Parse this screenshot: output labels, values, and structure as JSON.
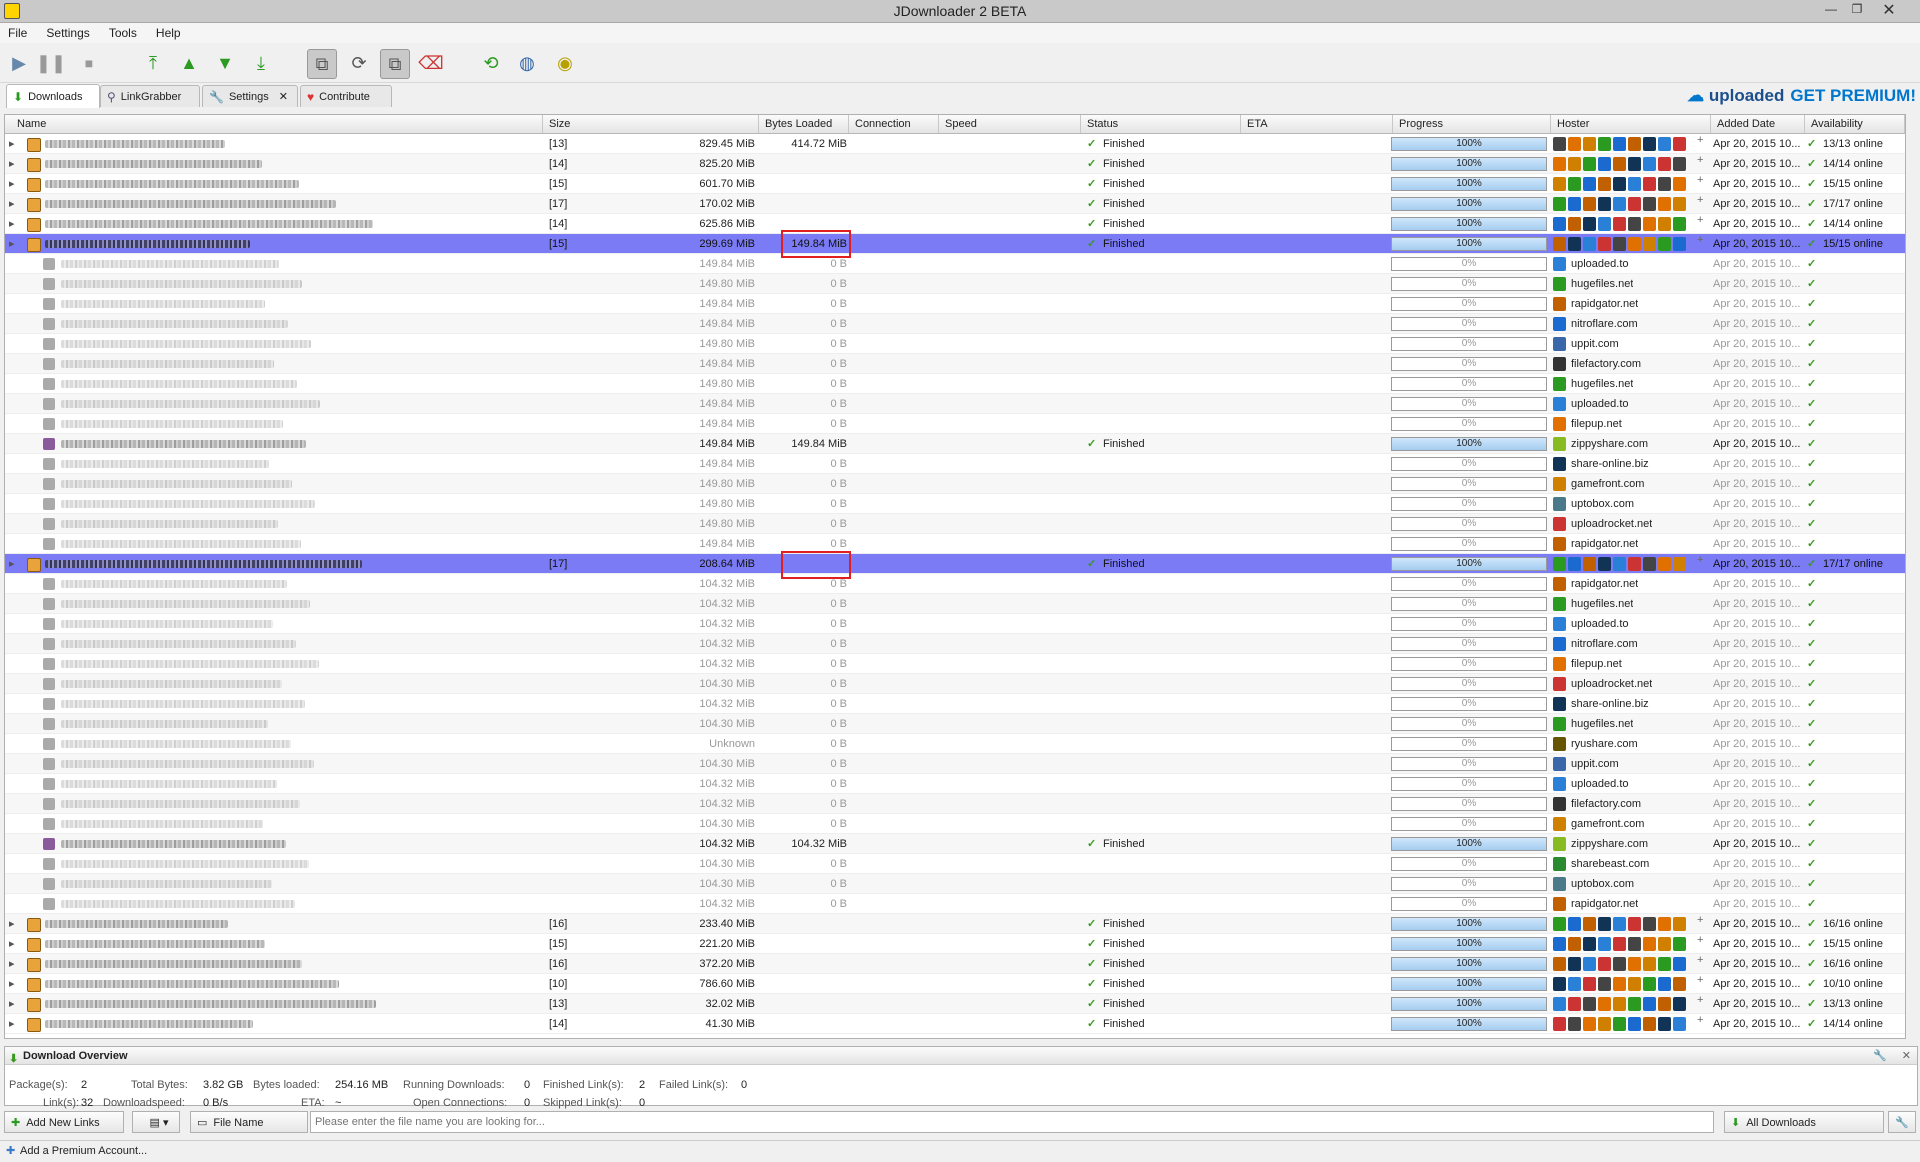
{
  "window": {
    "title": "JDownloader 2 BETA"
  },
  "menu": [
    "File",
    "Settings",
    "Tools",
    "Help"
  ],
  "tabs": [
    {
      "label": "Downloads"
    },
    {
      "label": "LinkGrabber"
    },
    {
      "label": "Settings"
    },
    {
      "label": "Contribute"
    }
  ],
  "banner": {
    "brand": "uploaded",
    "cta": "GET PREMIUM!"
  },
  "columns": [
    "Name",
    "Size",
    "Bytes Loaded",
    "Connection",
    "Speed",
    "Status",
    "ETA",
    "Progress",
    "Hoster",
    "Added Date",
    "Availability"
  ],
  "rows": [
    {
      "kind": "package",
      "count": "[13]",
      "size": "829.45 MiB",
      "loaded": "414.72 MiB",
      "status": "Finished",
      "progress": "100%",
      "date": "Apr 20, 2015 10...",
      "avail": "13/13 online"
    },
    {
      "kind": "package",
      "count": "[14]",
      "size": "825.20 MiB",
      "loaded": "",
      "status": "Finished",
      "progress": "100%",
      "date": "Apr 20, 2015 10...",
      "avail": "14/14 online"
    },
    {
      "kind": "package",
      "count": "[15]",
      "size": "601.70 MiB",
      "loaded": "",
      "status": "Finished",
      "progress": "100%",
      "date": "Apr 20, 2015 10...",
      "avail": "15/15 online"
    },
    {
      "kind": "package",
      "count": "[17]",
      "size": "170.02 MiB",
      "loaded": "",
      "status": "Finished",
      "progress": "100%",
      "date": "Apr 20, 2015 10...",
      "avail": "17/17 online"
    },
    {
      "kind": "package",
      "count": "[14]",
      "size": "625.86 MiB",
      "loaded": "",
      "status": "Finished",
      "progress": "100%",
      "date": "Apr 20, 2015 10...",
      "avail": "14/14 online"
    },
    {
      "kind": "package",
      "selected": true,
      "count": "[15]",
      "size": "299.69 MiB",
      "loaded": "149.84 MiB",
      "status": "Finished",
      "progress": "100%",
      "date": "Apr 20, 2015 10...",
      "avail": "15/15 online"
    },
    {
      "kind": "child",
      "size": "149.84 MiB",
      "loaded": "0 B",
      "progress": "0%",
      "hoster": "uploaded.to",
      "date": "Apr 20, 2015 10..."
    },
    {
      "kind": "child",
      "size": "149.80 MiB",
      "loaded": "0 B",
      "progress": "0%",
      "hoster": "hugefiles.net",
      "date": "Apr 20, 2015 10..."
    },
    {
      "kind": "child",
      "size": "149.84 MiB",
      "loaded": "0 B",
      "progress": "0%",
      "hoster": "rapidgator.net",
      "date": "Apr 20, 2015 10..."
    },
    {
      "kind": "child",
      "size": "149.84 MiB",
      "loaded": "0 B",
      "progress": "0%",
      "hoster": "nitroflare.com",
      "date": "Apr 20, 2015 10..."
    },
    {
      "kind": "child",
      "size": "149.80 MiB",
      "loaded": "0 B",
      "progress": "0%",
      "hoster": "uppit.com",
      "date": "Apr 20, 2015 10..."
    },
    {
      "kind": "child",
      "size": "149.84 MiB",
      "loaded": "0 B",
      "progress": "0%",
      "hoster": "filefactory.com",
      "date": "Apr 20, 2015 10..."
    },
    {
      "kind": "child",
      "size": "149.80 MiB",
      "loaded": "0 B",
      "progress": "0%",
      "hoster": "hugefiles.net",
      "date": "Apr 20, 2015 10..."
    },
    {
      "kind": "child",
      "size": "149.84 MiB",
      "loaded": "0 B",
      "progress": "0%",
      "hoster": "uploaded.to",
      "date": "Apr 20, 2015 10..."
    },
    {
      "kind": "child",
      "size": "149.84 MiB",
      "loaded": "0 B",
      "progress": "0%",
      "hoster": "filepup.net",
      "date": "Apr 20, 2015 10..."
    },
    {
      "kind": "child",
      "done": true,
      "size": "149.84 MiB",
      "loaded": "149.84 MiB",
      "status": "Finished",
      "progress": "100%",
      "hoster": "zippyshare.com",
      "date": "Apr 20, 2015 10..."
    },
    {
      "kind": "child",
      "size": "149.84 MiB",
      "loaded": "0 B",
      "progress": "0%",
      "hoster": "share-online.biz",
      "date": "Apr 20, 2015 10..."
    },
    {
      "kind": "child",
      "size": "149.80 MiB",
      "loaded": "0 B",
      "progress": "0%",
      "hoster": "gamefront.com",
      "date": "Apr 20, 2015 10..."
    },
    {
      "kind": "child",
      "size": "149.80 MiB",
      "loaded": "0 B",
      "progress": "0%",
      "hoster": "uptobox.com",
      "date": "Apr 20, 2015 10..."
    },
    {
      "kind": "child",
      "size": "149.80 MiB",
      "loaded": "0 B",
      "progress": "0%",
      "hoster": "uploadrocket.net",
      "date": "Apr 20, 2015 10..."
    },
    {
      "kind": "child",
      "size": "149.84 MiB",
      "loaded": "0 B",
      "progress": "0%",
      "hoster": "rapidgator.net",
      "date": "Apr 20, 2015 10..."
    },
    {
      "kind": "package",
      "selected": true,
      "count": "[17]",
      "size": "208.64 MiB",
      "loaded": "",
      "status": "Finished",
      "progress": "100%",
      "date": "Apr 20, 2015 10...",
      "avail": "17/17 online"
    },
    {
      "kind": "child",
      "size": "104.32 MiB",
      "loaded": "0 B",
      "progress": "0%",
      "hoster": "rapidgator.net",
      "date": "Apr 20, 2015 10..."
    },
    {
      "kind": "child",
      "size": "104.32 MiB",
      "loaded": "0 B",
      "progress": "0%",
      "hoster": "hugefiles.net",
      "date": "Apr 20, 2015 10..."
    },
    {
      "kind": "child",
      "size": "104.32 MiB",
      "loaded": "0 B",
      "progress": "0%",
      "hoster": "uploaded.to",
      "date": "Apr 20, 2015 10..."
    },
    {
      "kind": "child",
      "size": "104.32 MiB",
      "loaded": "0 B",
      "progress": "0%",
      "hoster": "nitroflare.com",
      "date": "Apr 20, 2015 10..."
    },
    {
      "kind": "child",
      "size": "104.32 MiB",
      "loaded": "0 B",
      "progress": "0%",
      "hoster": "filepup.net",
      "date": "Apr 20, 2015 10..."
    },
    {
      "kind": "child",
      "size": "104.30 MiB",
      "loaded": "0 B",
      "progress": "0%",
      "hoster": "uploadrocket.net",
      "date": "Apr 20, 2015 10..."
    },
    {
      "kind": "child",
      "size": "104.32 MiB",
      "loaded": "0 B",
      "progress": "0%",
      "hoster": "share-online.biz",
      "date": "Apr 20, 2015 10..."
    },
    {
      "kind": "child",
      "size": "104.30 MiB",
      "loaded": "0 B",
      "progress": "0%",
      "hoster": "hugefiles.net",
      "date": "Apr 20, 2015 10..."
    },
    {
      "kind": "child",
      "size": "Unknown",
      "loaded": "0 B",
      "progress": "0%",
      "hoster": "ryushare.com",
      "date": "Apr 20, 2015 10..."
    },
    {
      "kind": "child",
      "size": "104.30 MiB",
      "loaded": "0 B",
      "progress": "0%",
      "hoster": "uppit.com",
      "date": "Apr 20, 2015 10..."
    },
    {
      "kind": "child",
      "size": "104.32 MiB",
      "loaded": "0 B",
      "progress": "0%",
      "hoster": "uploaded.to",
      "date": "Apr 20, 2015 10..."
    },
    {
      "kind": "child",
      "size": "104.32 MiB",
      "loaded": "0 B",
      "progress": "0%",
      "hoster": "filefactory.com",
      "date": "Apr 20, 2015 10..."
    },
    {
      "kind": "child",
      "size": "104.30 MiB",
      "loaded": "0 B",
      "progress": "0%",
      "hoster": "gamefront.com",
      "date": "Apr 20, 2015 10..."
    },
    {
      "kind": "child",
      "done": true,
      "size": "104.32 MiB",
      "loaded": "104.32 MiB",
      "status": "Finished",
      "progress": "100%",
      "hoster": "zippyshare.com",
      "date": "Apr 20, 2015 10..."
    },
    {
      "kind": "child",
      "size": "104.30 MiB",
      "loaded": "0 B",
      "progress": "0%",
      "hoster": "sharebeast.com",
      "date": "Apr 20, 2015 10..."
    },
    {
      "kind": "child",
      "size": "104.30 MiB",
      "loaded": "0 B",
      "progress": "0%",
      "hoster": "uptobox.com",
      "date": "Apr 20, 2015 10..."
    },
    {
      "kind": "child",
      "size": "104.32 MiB",
      "loaded": "0 B",
      "progress": "0%",
      "hoster": "rapidgator.net",
      "date": "Apr 20, 2015 10..."
    },
    {
      "kind": "package",
      "count": "[16]",
      "size": "233.40 MiB",
      "loaded": "",
      "status": "Finished",
      "progress": "100%",
      "date": "Apr 20, 2015 10...",
      "avail": "16/16 online"
    },
    {
      "kind": "package",
      "count": "[15]",
      "size": "221.20 MiB",
      "loaded": "",
      "status": "Finished",
      "progress": "100%",
      "date": "Apr 20, 2015 10...",
      "avail": "15/15 online"
    },
    {
      "kind": "package",
      "count": "[16]",
      "size": "372.20 MiB",
      "loaded": "",
      "status": "Finished",
      "progress": "100%",
      "date": "Apr 20, 2015 10...",
      "avail": "16/16 online"
    },
    {
      "kind": "package",
      "count": "[10]",
      "size": "786.60 MiB",
      "loaded": "",
      "status": "Finished",
      "progress": "100%",
      "date": "Apr 20, 2015 10...",
      "avail": "10/10 online"
    },
    {
      "kind": "package",
      "count": "[13]",
      "size": "32.02 MiB",
      "loaded": "",
      "status": "Finished",
      "progress": "100%",
      "date": "Apr 20, 2015 10...",
      "avail": "13/13 online"
    },
    {
      "kind": "package",
      "count": "[14]",
      "size": "41.30 MiB",
      "loaded": "",
      "status": "Finished",
      "progress": "100%",
      "date": "Apr 20, 2015 10...",
      "avail": "14/14 online"
    }
  ],
  "overview": {
    "title": "Download Overview",
    "items": [
      {
        "k": "Package(s):",
        "v": "2"
      },
      {
        "k": "Total Bytes:",
        "v": "3.82 GB"
      },
      {
        "k": "Bytes loaded:",
        "v": "254.16 MB"
      },
      {
        "k": "Running Downloads:",
        "v": "0"
      },
      {
        "k": "Finished Link(s):",
        "v": "2"
      },
      {
        "k": "Failed Link(s):",
        "v": "0"
      },
      {
        "k": "Link(s):",
        "v": "32"
      },
      {
        "k": "Downloadspeed:",
        "v": "0 B/s"
      },
      {
        "k": "ETA:",
        "v": "~"
      },
      {
        "k": "Open Connections:",
        "v": "0"
      },
      {
        "k": "Skipped Link(s):",
        "v": "0"
      }
    ]
  },
  "bottom": {
    "add_links": "Add New Links",
    "search_field": "File Name",
    "search_placeholder": "Please enter the file name you are looking for...",
    "all_downloads": "All Downloads"
  },
  "status": {
    "add_premium": "Add a Premium Account..."
  },
  "colors": {
    "selected_row": "#7b7bf5",
    "accent_green": "#3a9a20",
    "highlight_box": "#e02020"
  }
}
